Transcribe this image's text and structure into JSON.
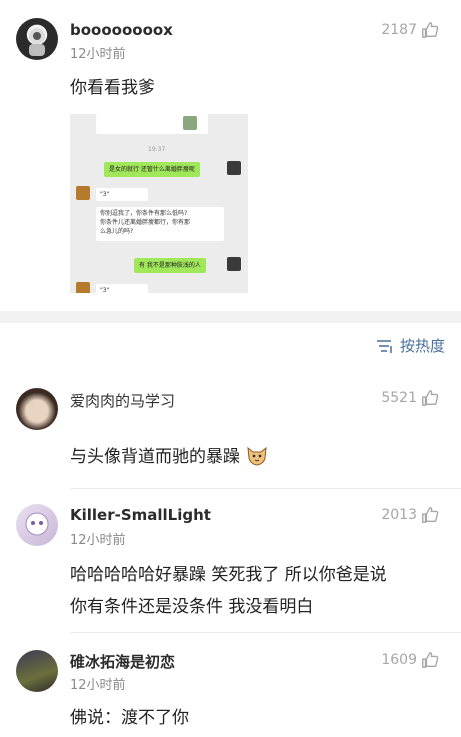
{
  "post": {
    "username": "boooooooox",
    "time": "12小时前",
    "likes": "2187",
    "text": "你看看我爹",
    "chat": {
      "timestamp": "19:37",
      "msg1": "是女的就行 还管什么离婚胖瘦呢",
      "voice1": "\"3\"",
      "reply_line1": "你别逗我了，你条件有那么低吗?",
      "reply_line2": "你条件儿还离婚胖瘦都行，你有那",
      "reply_line3": "么急儿的吗?",
      "msg2": "有 我不是那种肤浅的人",
      "voice2": "\"3\""
    }
  },
  "sort_label": "按热度",
  "comments": [
    {
      "username": "爱肉肉的马学习",
      "time": "",
      "likes": "5521",
      "text": [
        "与头像背道而驰的暴躁"
      ],
      "emoji": "cat-emoji"
    },
    {
      "username": "Killer-SmallLight",
      "time": "12小时前",
      "likes": "2013",
      "text": [
        "哈哈哈哈哈好暴躁 笑死我了 所以你爸是说",
        "你有条件还是没条件 我没看明白"
      ]
    },
    {
      "username": "碓冰拓海是初恋",
      "time": "12小时前",
      "likes": "1609",
      "text": [
        "佛说：渡不了你"
      ]
    }
  ],
  "colors": {
    "accent": "#4a6f9c",
    "chat_green": "#a0e75a"
  }
}
